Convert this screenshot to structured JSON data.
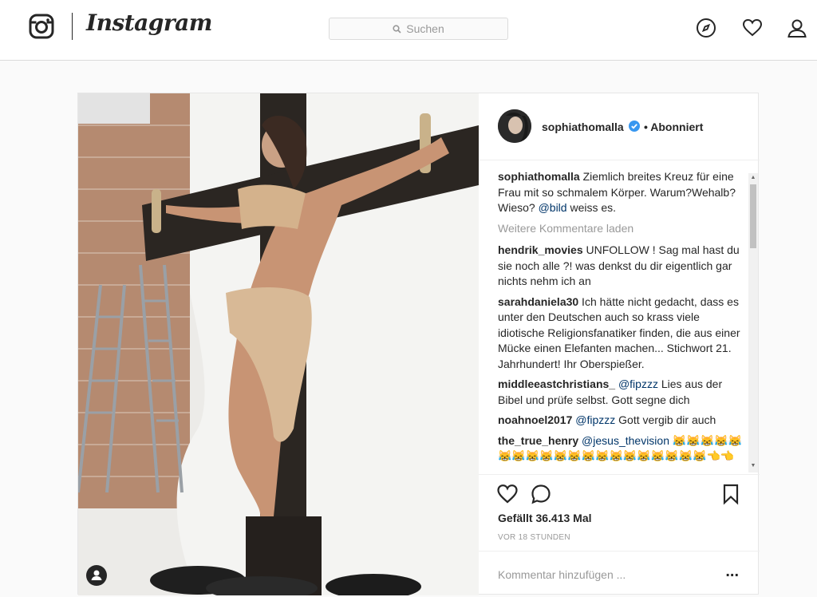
{
  "header": {
    "wordmark": "Instagram",
    "search_placeholder": "Suchen",
    "icons": [
      "instagram-logo-icon",
      "search-icon",
      "explore-compass-icon",
      "heart-icon",
      "profile-icon"
    ]
  },
  "post": {
    "username": "sophiathomalla",
    "follow_status": "• Abonniert",
    "caption": {
      "user": "sophiathomalla",
      "text": " Ziemlich breites Kreuz für eine Frau mit so schmalem Körper. Warum?Wehalb?Wieso? ",
      "mention": "@bild",
      "text_after": " weiss es."
    },
    "load_more": "Weitere Kommentare laden",
    "comments": [
      {
        "user": "hendrik_movies",
        "mention": "",
        "text": " UNFOLLOW ! Sag mal hast du sie noch alle ?! was denkst du dir eigentlich gar nichts nehm ich an"
      },
      {
        "user": "sarahdaniela30",
        "mention": "",
        "text": " Ich hätte nicht gedacht, dass es unter den Deutschen auch so krass viele idiotische Religionsfanatiker finden, die aus einer Mücke einen Elefanten machen... Stichwort 21. Jahrhundert! Ihr Oberspießer."
      },
      {
        "user": "middleeastchristians_",
        "mention": " @fipzzz",
        "text": " Lies aus der Bibel und prüfe selbst. Gott segne dich"
      },
      {
        "user": "noahnoel2017",
        "mention": " @fipzzz",
        "text": " Gott vergib dir auch"
      },
      {
        "user": "the_true_henry",
        "mention": " @jesus_thevision",
        "text": " 😹😹😹😹😹😹😹😹😹😹😹😹😹😹😹😹😹😹😹😹👈👈"
      }
    ],
    "likes": "Gefällt 36.413 Mal",
    "time": "VOR 18 STUNDEN",
    "comment_placeholder": "Kommentar hinzufügen ...",
    "more_options": "..."
  },
  "colors": {
    "mention": "#003569",
    "muted": "#999999",
    "verified": "#3897f0"
  }
}
